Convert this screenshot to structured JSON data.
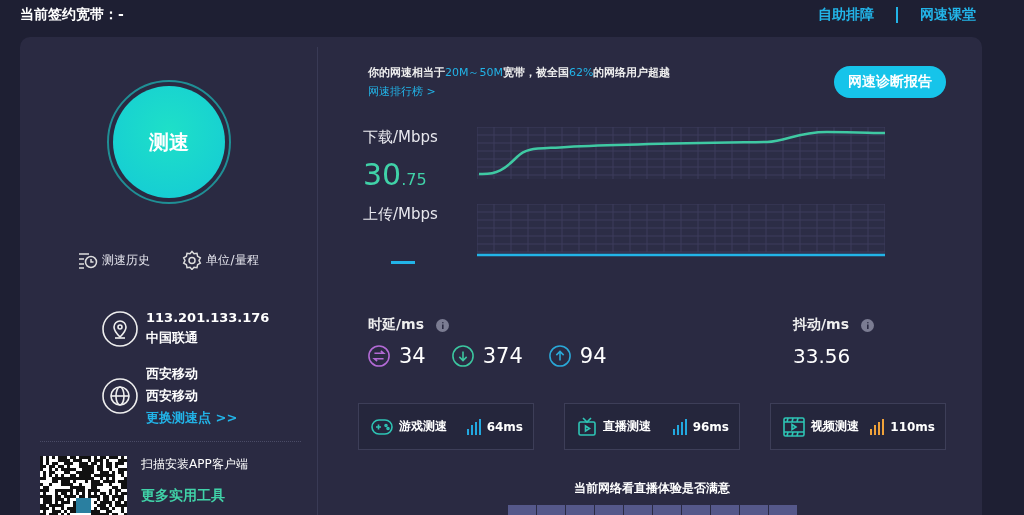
{
  "header": {
    "contract_label": "当前签约宽带：-",
    "links": [
      {
        "label": "自助排障"
      },
      {
        "label": "网速课堂"
      }
    ]
  },
  "left": {
    "start_button": "测速",
    "tools": [
      {
        "kind": "history",
        "label": "测速历史"
      },
      {
        "kind": "settings",
        "label": "单位/量程"
      }
    ],
    "ip": {
      "address": "113.201.133.176",
      "isp": "中国联通"
    },
    "server": {
      "name": "西安移动",
      "operator": "西安移动",
      "change_link": "更换测速点 >>"
    },
    "app": {
      "prompt": "扫描安装APP客户端",
      "tools_link": "更多实用工具"
    }
  },
  "summary": {
    "segments": [
      {
        "text": "你的网速相当于",
        "highlight": false
      },
      {
        "text": "20M～50M",
        "highlight": true
      },
      {
        "text": "宽带，被全国",
        "highlight": false
      },
      {
        "text": "62%",
        "highlight": true
      },
      {
        "text": "的网络用户超越",
        "highlight": false
      }
    ],
    "link": "网速排行榜 >",
    "report_button": "网速诊断报告"
  },
  "download": {
    "label": "下载/Mbps",
    "value_int": "30",
    "value_dec": ".75"
  },
  "upload": {
    "label": "上传/Mbps"
  },
  "latency": {
    "label": "时延/ms",
    "items": [
      {
        "kind": "idle",
        "value": "34"
      },
      {
        "kind": "download",
        "value": "374"
      },
      {
        "kind": "upload",
        "value": "94"
      }
    ]
  },
  "jitter": {
    "label": "抖动/ms",
    "value": "33.56"
  },
  "tests": [
    {
      "kind": "game",
      "label": "游戏测速",
      "latency": "64ms",
      "color": "#22a9e0"
    },
    {
      "kind": "live",
      "label": "直播测速",
      "latency": "96ms",
      "color": "#22a9e0"
    },
    {
      "kind": "video",
      "label": "视频测速",
      "latency": "110ms",
      "color": "#f0a23a"
    }
  ],
  "feedback": {
    "question": "当前网络看直播体验是否满意",
    "options": [
      {
        "selected": false
      },
      {
        "selected": false
      },
      {
        "selected": false
      },
      {
        "selected": false
      },
      {
        "selected": false
      },
      {
        "selected": false
      },
      {
        "selected": false
      },
      {
        "selected": false
      },
      {
        "selected": false
      },
      {
        "selected": false
      }
    ]
  }
}
